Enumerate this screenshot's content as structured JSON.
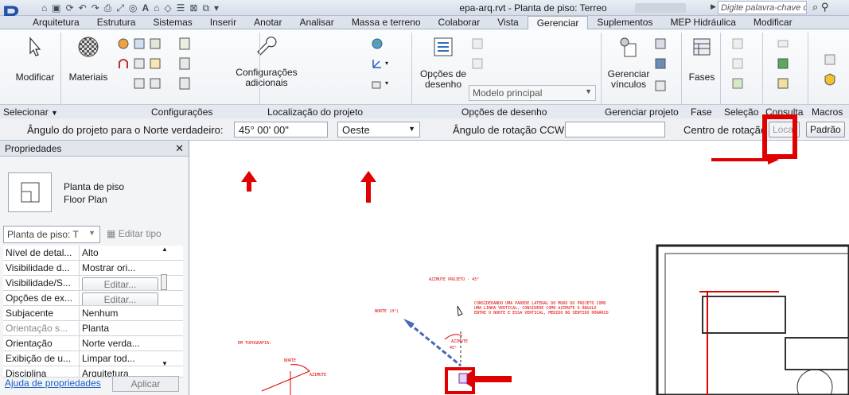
{
  "title_bar": {
    "document_title": "epa-arq.rvt - Planta de piso: Terreo",
    "search_placeholder": "Digite palavra-chave ou frase"
  },
  "tabs": [
    {
      "label": "Arquitetura"
    },
    {
      "label": "Estrutura"
    },
    {
      "label": "Sistemas"
    },
    {
      "label": "Inserir"
    },
    {
      "label": "Anotar"
    },
    {
      "label": "Analisar"
    },
    {
      "label": "Massa e terreno"
    },
    {
      "label": "Colaborar"
    },
    {
      "label": "Vista"
    },
    {
      "label": "Gerenciar",
      "active": true
    },
    {
      "label": "Suplementos"
    },
    {
      "label": "MEP Hidráulica"
    },
    {
      "label": "Modificar"
    }
  ],
  "ribbon": {
    "modificar": "Modificar",
    "materiais": "Materiais",
    "config_line1": "Configurações",
    "config_line2": "adicionais",
    "opcoes_line1": "Opções de",
    "opcoes_line2": "desenho",
    "modelo_principal": "Modelo principal",
    "gerenciar_line1": "Gerenciar",
    "gerenciar_line2": "vínculos",
    "fases": "Fases",
    "panels": {
      "selecionar": "Selecionar",
      "configuracoes": "Configurações",
      "localizacao": "Localização do projeto",
      "opcoes_desenho": "Opções de desenho",
      "gerenciar_projeto": "Gerenciar projeto",
      "fase": "Fase",
      "selecao": "Seleção",
      "consulta": "Consulta",
      "macros": "Macros"
    }
  },
  "options_bar": {
    "angle_label": "Ângulo do projeto para o Norte verdadeiro:",
    "angle_value": "45° 00' 00\"",
    "direction_value": "Oeste",
    "rotation_label": "Ângulo de rotação CCW:",
    "rotation_value": "",
    "center_label": "Centro de rotação",
    "local_label": "Local",
    "padrao_label": "Padrão"
  },
  "properties": {
    "title": "Propriedades",
    "type_line1": "Planta de piso",
    "type_line2": "Floor Plan",
    "type_selector": "Planta de piso: T",
    "edit_type": "Editar tipo",
    "rows": [
      {
        "key": "Nível de detal...",
        "value": "Alto"
      },
      {
        "key": "Visibilidade d...",
        "value": "Mostrar ori..."
      },
      {
        "key": "Visibilidade/S...",
        "value": "Editar...",
        "button": true
      },
      {
        "key": "Opções de ex...",
        "value": "Editar...",
        "button": true
      },
      {
        "key": "Subjacente",
        "value": "Nenhum"
      },
      {
        "key": "Orientação s...",
        "value": "Planta",
        "grey": true
      },
      {
        "key": "Orientação",
        "value": "Norte verda..."
      },
      {
        "key": "Exibição de u...",
        "value": "Limpar tod..."
      },
      {
        "key": "Disciplina",
        "value": "Arquitetura"
      }
    ],
    "help_link": "Ajuda de propriedades",
    "apply": "Aplicar"
  },
  "canvas": {
    "note_title": "AZIMUTE PROJETO - 45°",
    "note_body_1": "CONSIDERANDO UMA PAREDE LATERAL DO MURO DO PROJETO COMO",
    "note_body_2": "UMA LINHA VERTICAL, CONSIDERE COMO AZIMUTE O ÂNGULO",
    "note_body_3": "ENTRE O NORTE E ESSA VERTICAL, MEDIDO NO SENTIDO HORÁRIO",
    "norte_0": "NORTE (0°)",
    "azimute": "AZIMUTE",
    "azimute_angle": "45°",
    "topografia": "EM TOPOGRAFIA:",
    "norte": "NORTE",
    "azimute2": "AZIMUTE"
  }
}
